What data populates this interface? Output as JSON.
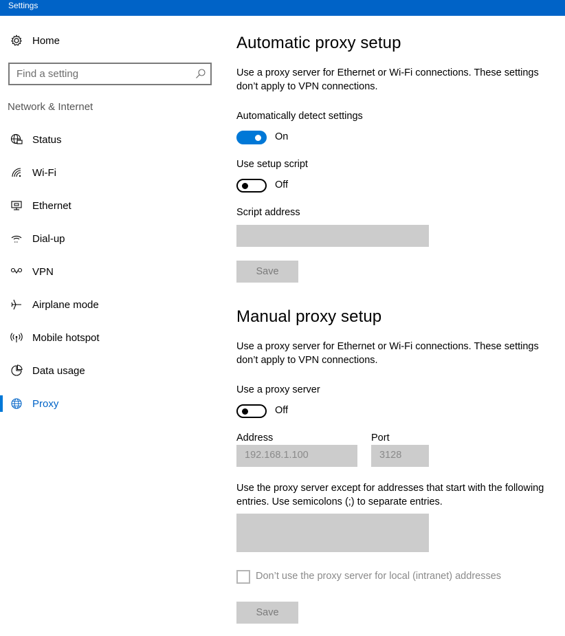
{
  "window": {
    "title": "Settings"
  },
  "sidebar": {
    "home_label": "Home",
    "search_placeholder": "Find a setting",
    "section_label": "Network & Internet",
    "items": [
      {
        "label": "Status",
        "icon": "globe-monitor-icon"
      },
      {
        "label": "Wi-Fi",
        "icon": "wifi-icon"
      },
      {
        "label": "Ethernet",
        "icon": "ethernet-icon"
      },
      {
        "label": "Dial-up",
        "icon": "dialup-icon"
      },
      {
        "label": "VPN",
        "icon": "vpn-icon"
      },
      {
        "label": "Airplane mode",
        "icon": "airplane-icon"
      },
      {
        "label": "Mobile hotspot",
        "icon": "hotspot-icon"
      },
      {
        "label": "Data usage",
        "icon": "pie-chart-icon"
      },
      {
        "label": "Proxy",
        "icon": "globe-icon",
        "active": true
      }
    ]
  },
  "auto": {
    "heading": "Automatic proxy setup",
    "description": "Use a proxy server for Ethernet or Wi-Fi connections. These settings don’t apply to VPN connections.",
    "detect_label": "Automatically detect settings",
    "detect_state": "On",
    "script_label": "Use setup script",
    "script_state": "Off",
    "address_label": "Script address",
    "address_value": "",
    "save_label": "Save"
  },
  "manual": {
    "heading": "Manual proxy setup",
    "description": "Use a proxy server for Ethernet or Wi-Fi connections. These settings don’t apply to VPN connections.",
    "use_label": "Use a proxy server",
    "use_state": "Off",
    "address_label": "Address",
    "address_value": "192.168.1.100",
    "port_label": "Port",
    "port_value": "3128",
    "exceptions_label": "Use the proxy server except for addresses that start with the following entries. Use semicolons (;) to separate entries.",
    "exceptions_value": "",
    "local_checkbox_label": "Don’t use the proxy server for local (intranet) addresses",
    "local_checked": false,
    "save_label": "Save"
  },
  "colors": {
    "titlebar": "#0063c7",
    "accent": "#0078d7",
    "disabled_field": "#cccccc"
  }
}
